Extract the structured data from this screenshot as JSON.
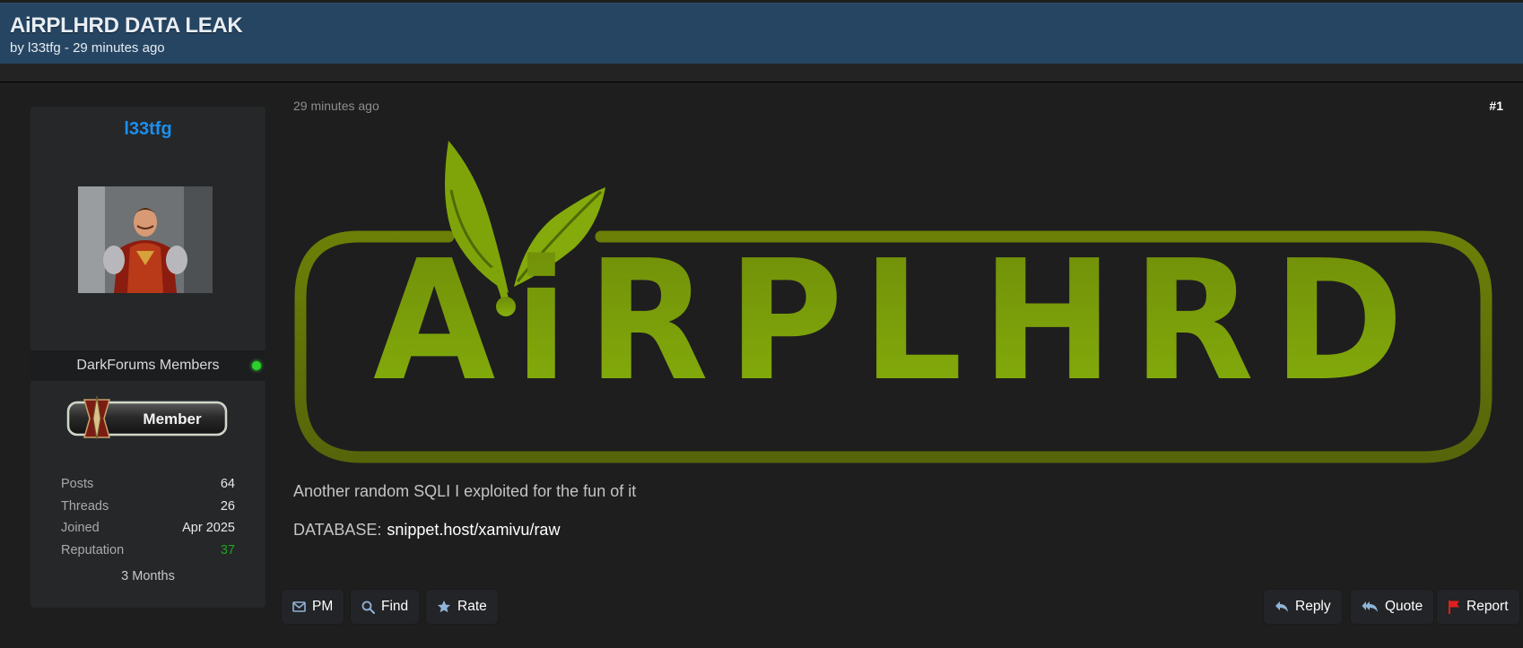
{
  "thread": {
    "title": "AiRPLHRD DATA LEAK",
    "by_prefix": "by",
    "author": "l33tfg",
    "separator": "-",
    "time_ago": "29 minutes ago"
  },
  "profile": {
    "username": "l33tfg",
    "group": "DarkForums Members",
    "badge_label": "Member",
    "stats": [
      {
        "label": "Posts",
        "value": "64"
      },
      {
        "label": "Threads",
        "value": "26"
      },
      {
        "label": "Joined",
        "value": "Apr 2025"
      },
      {
        "label": "Reputation",
        "value": "37"
      }
    ],
    "membership_length": "3 Months"
  },
  "post": {
    "date": "29 minutes ago",
    "number": "#1",
    "logo_text": "AiRPLHRD",
    "body_line": "Another random SQLI I exploited for the fun of it",
    "database_label": "DATABASE:",
    "database_link": "snippet.host/xamivu/raw"
  },
  "actions": {
    "pm": "PM",
    "find": "Find",
    "rate": "Rate",
    "reply": "Reply",
    "quote": "Quote",
    "report": "Report"
  },
  "colors": {
    "header_bg": "#254563",
    "username": "#1b8ff0",
    "reputation": "#1fa51f",
    "logo_green": "#7da80a",
    "online": "#2bd22b",
    "report_flag": "#e0201e"
  }
}
